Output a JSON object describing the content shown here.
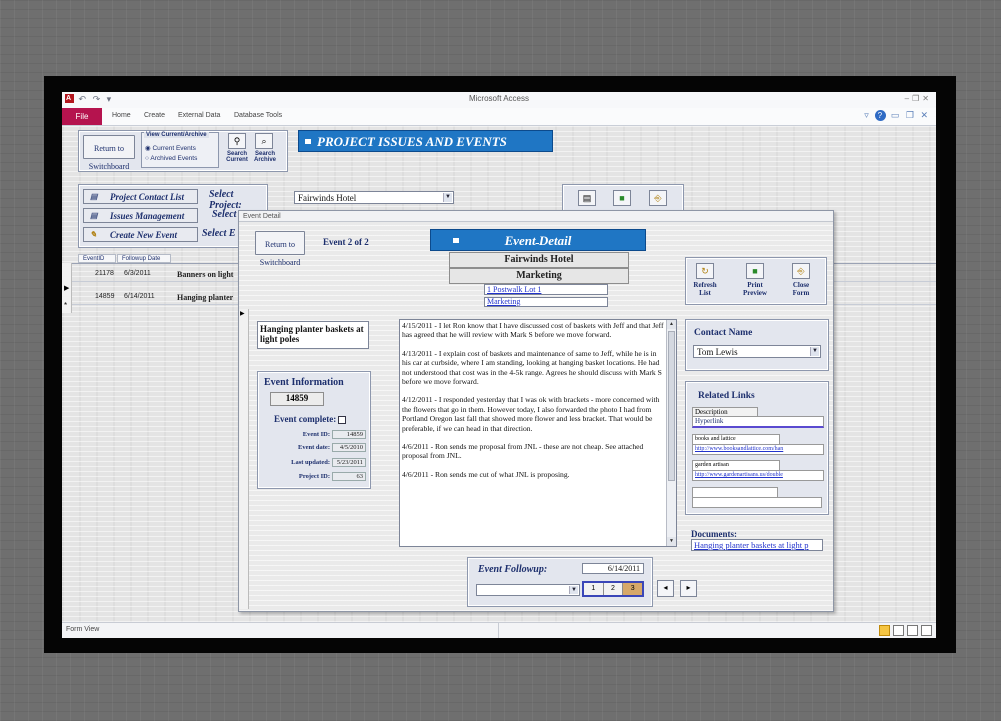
{
  "app": {
    "title": "Microsoft Access",
    "file_tab": "File",
    "ribbon_tabs": [
      "Home",
      "Create",
      "External Data",
      "Database Tools"
    ],
    "status": "Form View"
  },
  "switchboard": {
    "return_btn": "Return to Switchboard",
    "view_label": "View Current/Archive",
    "radio_current": "Current Events",
    "radio_archived": "Archived Events",
    "search_current": "Search Current",
    "search_archive": "Search Archive",
    "header_title": "PROJECT ISSUES AND EVENTS",
    "buttons": [
      "Project Contact List",
      "Issues Management",
      "Create New Event"
    ],
    "select_project_label": "Select Project:",
    "select_project_value": "Fairwinds Hotel",
    "select_2_label": "Select",
    "select_3_label": "Select E",
    "grid_headers": [
      "EventID",
      "Followup Date"
    ],
    "rows": [
      {
        "id": "21178",
        "date": "6/3/2011",
        "title": "Banners on light"
      },
      {
        "id": "14859",
        "date": "6/14/2011",
        "title": "Hanging planter"
      }
    ]
  },
  "event_detail": {
    "caption": "Event Detail",
    "return_btn": "Return to Switchboard",
    "counter": "Event 2 of 2",
    "title": "Event Detail",
    "project_name": "Fairwinds Hotel",
    "category": "Marketing",
    "lot_link": "1 Postwalk Lot 1",
    "marketing_link": "Marketing",
    "actions": [
      "Refresh List",
      "Print Preview",
      "Close Form"
    ],
    "event_title": "Hanging planter baskets at light poles",
    "info_heading": "Event Information",
    "info_number": "14859",
    "complete_label": "Event complete:",
    "fields": [
      {
        "label": "Event ID:",
        "value": "14859"
      },
      {
        "label": "Event date:",
        "value": "4/5/2010"
      },
      {
        "label": "Last updated:",
        "value": "5/23/2011"
      },
      {
        "label": "Project ID:",
        "value": "63"
      }
    ],
    "notes": [
      "4/15/2011 - I let Ron know that I have discussed cost of baskets with Jeff and that Jeff has agreed that he will review with Mark S before we move forward.",
      "4/13/2011 - I explain cost of baskets and maintenance of same to Jeff, while he is in his car at curbside, where I am standing, looking at hanging basket locations.  He had not understood that cost was in the 4-5k range.  Agrees he should discuss with Mark S before we move forward.",
      "4/12/2011 - I responded yesterday that I was ok with brackets - more concerned with the flowers that go in them.  However today, I also forwarded the photo I had from Portland Oregon last fall that showed more flower and less bracket.  That would be preferable, if we can head in that direction.",
      "4/6/2011 - Ron sends me proposal from JNL - these are not cheap.  See attached proposal from JNL.",
      "4/6/2011 - Ron sends me cut of what JNL is proposing."
    ],
    "contact_heading": "Contact Name",
    "contact_value": "Tom Lewis",
    "links_heading": "Related Links",
    "links_desc_header": "Description",
    "links_hyper_header": "Hyperlink",
    "links": [
      {
        "desc": "books and lattice",
        "url": "http://www.booksandlattice.com/han"
      },
      {
        "desc": "garden artisan",
        "url": "http://www.gardenartisans.us/double"
      }
    ],
    "documents_label": "Documents:",
    "documents_value": "Hanging planter baskets at light p",
    "followup_label": "Event Followup:",
    "followup_date": "6/14/2011",
    "pages": [
      "1",
      "2",
      "3"
    ]
  }
}
